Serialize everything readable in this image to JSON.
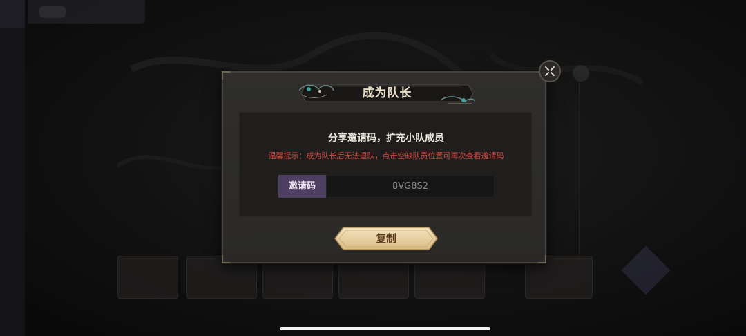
{
  "dialog": {
    "title": "成为队长",
    "heading": "分享邀请码，扩充小队成员",
    "tip": "温馨提示：成为队长后无法退队，点击空缺队员位置可再次查看邀请码",
    "invite_label": "邀请码",
    "invite_code": "8VG8S2",
    "copy_label": "复制"
  },
  "icons": {
    "close": "close-icon",
    "title_ornament": "cloud-ornament-icon"
  },
  "colors": {
    "tip_red": "#d7463f",
    "label_purple": "#4d3e62",
    "button_gold": "#e6cf9f",
    "panel": "#2f2e2c"
  }
}
